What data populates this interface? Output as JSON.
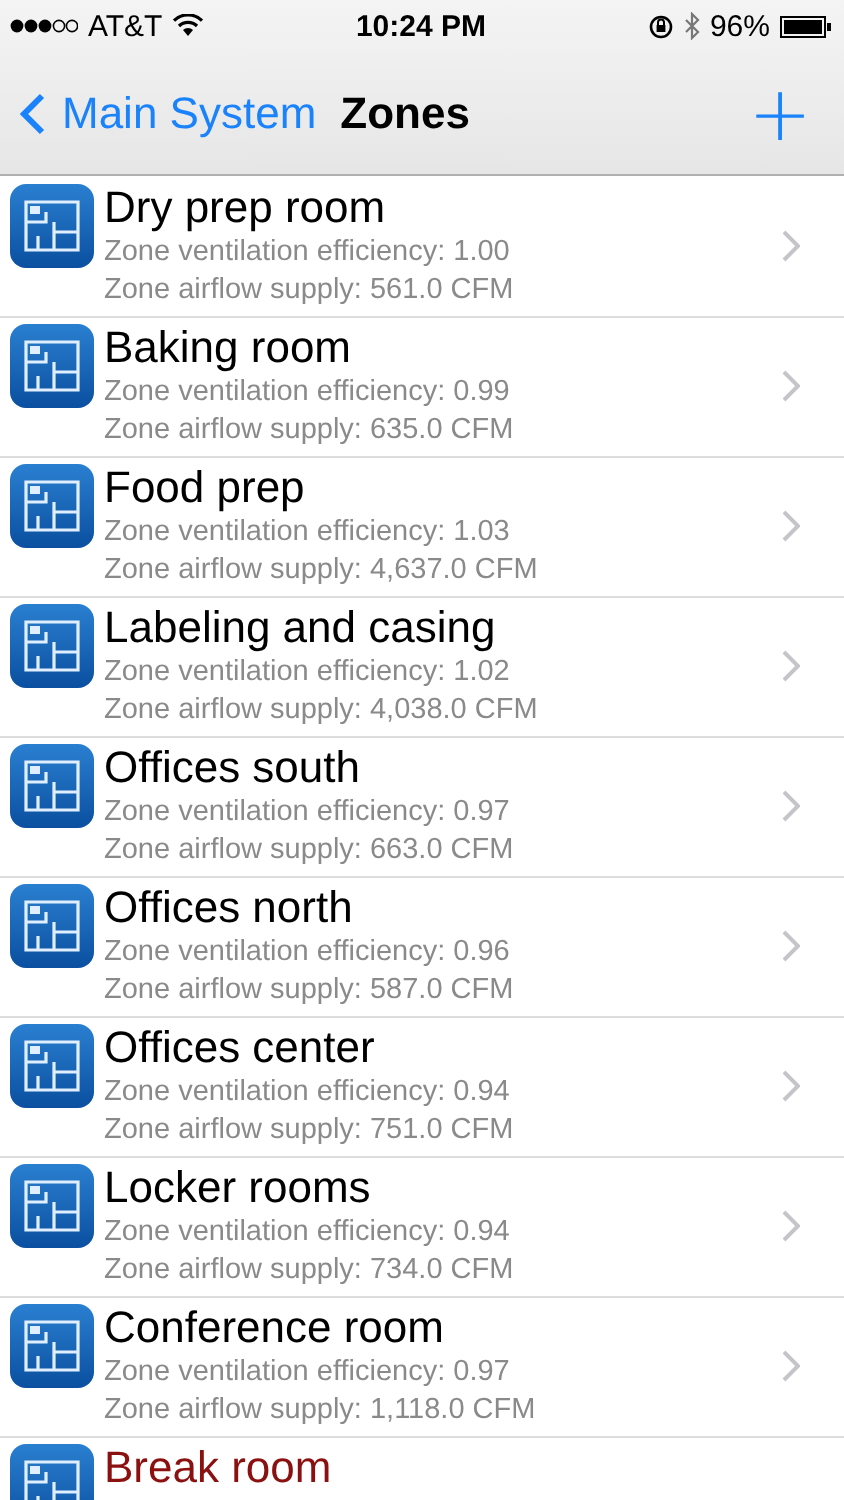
{
  "status_bar": {
    "carrier": "AT&T",
    "time": "10:24 PM",
    "battery": "96%"
  },
  "nav": {
    "back": "Main System",
    "title": "Zones",
    "add": "+"
  },
  "zones": [
    {
      "name": "Dry prep room",
      "color": "#000000",
      "efficiency": "Zone ventilation efficiency: 1.00",
      "airflow": "Zone airflow supply: 561.0 CFM"
    },
    {
      "name": "Baking room",
      "color": "#000000",
      "efficiency": "Zone ventilation efficiency: 0.99",
      "airflow": "Zone airflow supply: 635.0 CFM"
    },
    {
      "name": "Food prep",
      "color": "#000000",
      "efficiency": "Zone ventilation efficiency: 1.03",
      "airflow": "Zone airflow supply: 4,637.0 CFM"
    },
    {
      "name": "Labeling and casing",
      "color": "#000000",
      "efficiency": "Zone ventilation efficiency: 1.02",
      "airflow": "Zone airflow supply: 4,038.0 CFM"
    },
    {
      "name": "Offices south",
      "color": "#000000",
      "efficiency": "Zone ventilation efficiency: 0.97",
      "airflow": "Zone airflow supply: 663.0 CFM"
    },
    {
      "name": "Offices north",
      "color": "#000000",
      "efficiency": "Zone ventilation efficiency: 0.96",
      "airflow": "Zone airflow supply: 587.0 CFM"
    },
    {
      "name": "Offices center",
      "color": "#000000",
      "efficiency": "Zone ventilation efficiency: 0.94",
      "airflow": "Zone airflow supply: 751.0 CFM"
    },
    {
      "name": "Locker rooms",
      "color": "#000000",
      "efficiency": "Zone ventilation efficiency: 0.94",
      "airflow": "Zone airflow supply: 734.0 CFM"
    },
    {
      "name": "Conference room",
      "color": "#000000",
      "efficiency": "Zone ventilation efficiency: 0.97",
      "airflow": "Zone airflow supply: 1,118.0 CFM"
    },
    {
      "name": "Break room",
      "color": "#8b1010"
    }
  ]
}
